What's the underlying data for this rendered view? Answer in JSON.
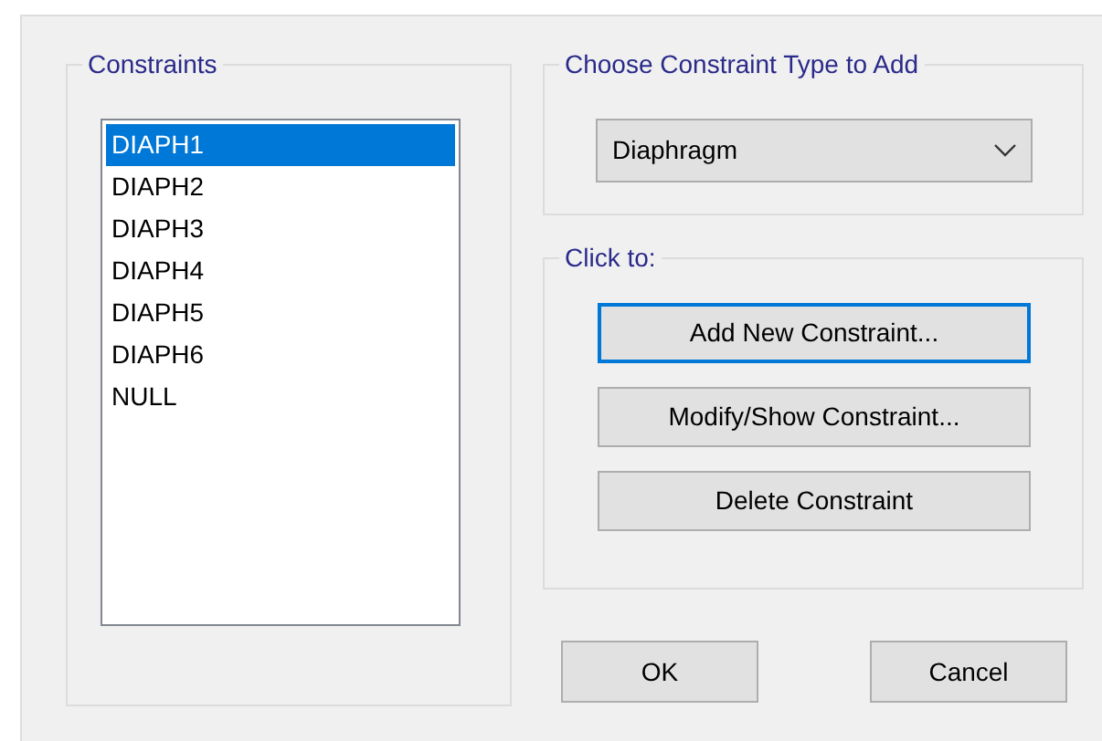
{
  "constraints": {
    "title": "Constraints",
    "items": [
      {
        "label": "DIAPH1",
        "selected": true
      },
      {
        "label": "DIAPH2",
        "selected": false
      },
      {
        "label": "DIAPH3",
        "selected": false
      },
      {
        "label": "DIAPH4",
        "selected": false
      },
      {
        "label": "DIAPH5",
        "selected": false
      },
      {
        "label": "DIAPH6",
        "selected": false
      },
      {
        "label": "NULL",
        "selected": false
      }
    ]
  },
  "type_group": {
    "title": "Choose Constraint Type to Add",
    "value": "Diaphragm"
  },
  "actions": {
    "title": "Click to:",
    "buttons": [
      {
        "label": "Add New Constraint...",
        "focused": true
      },
      {
        "label": "Modify/Show Constraint...",
        "focused": false
      },
      {
        "label": "Delete Constraint",
        "focused": false
      }
    ]
  },
  "footer_buttons": [
    {
      "label": "OK",
      "focused": false
    },
    {
      "label": "Cancel",
      "focused": false
    }
  ]
}
